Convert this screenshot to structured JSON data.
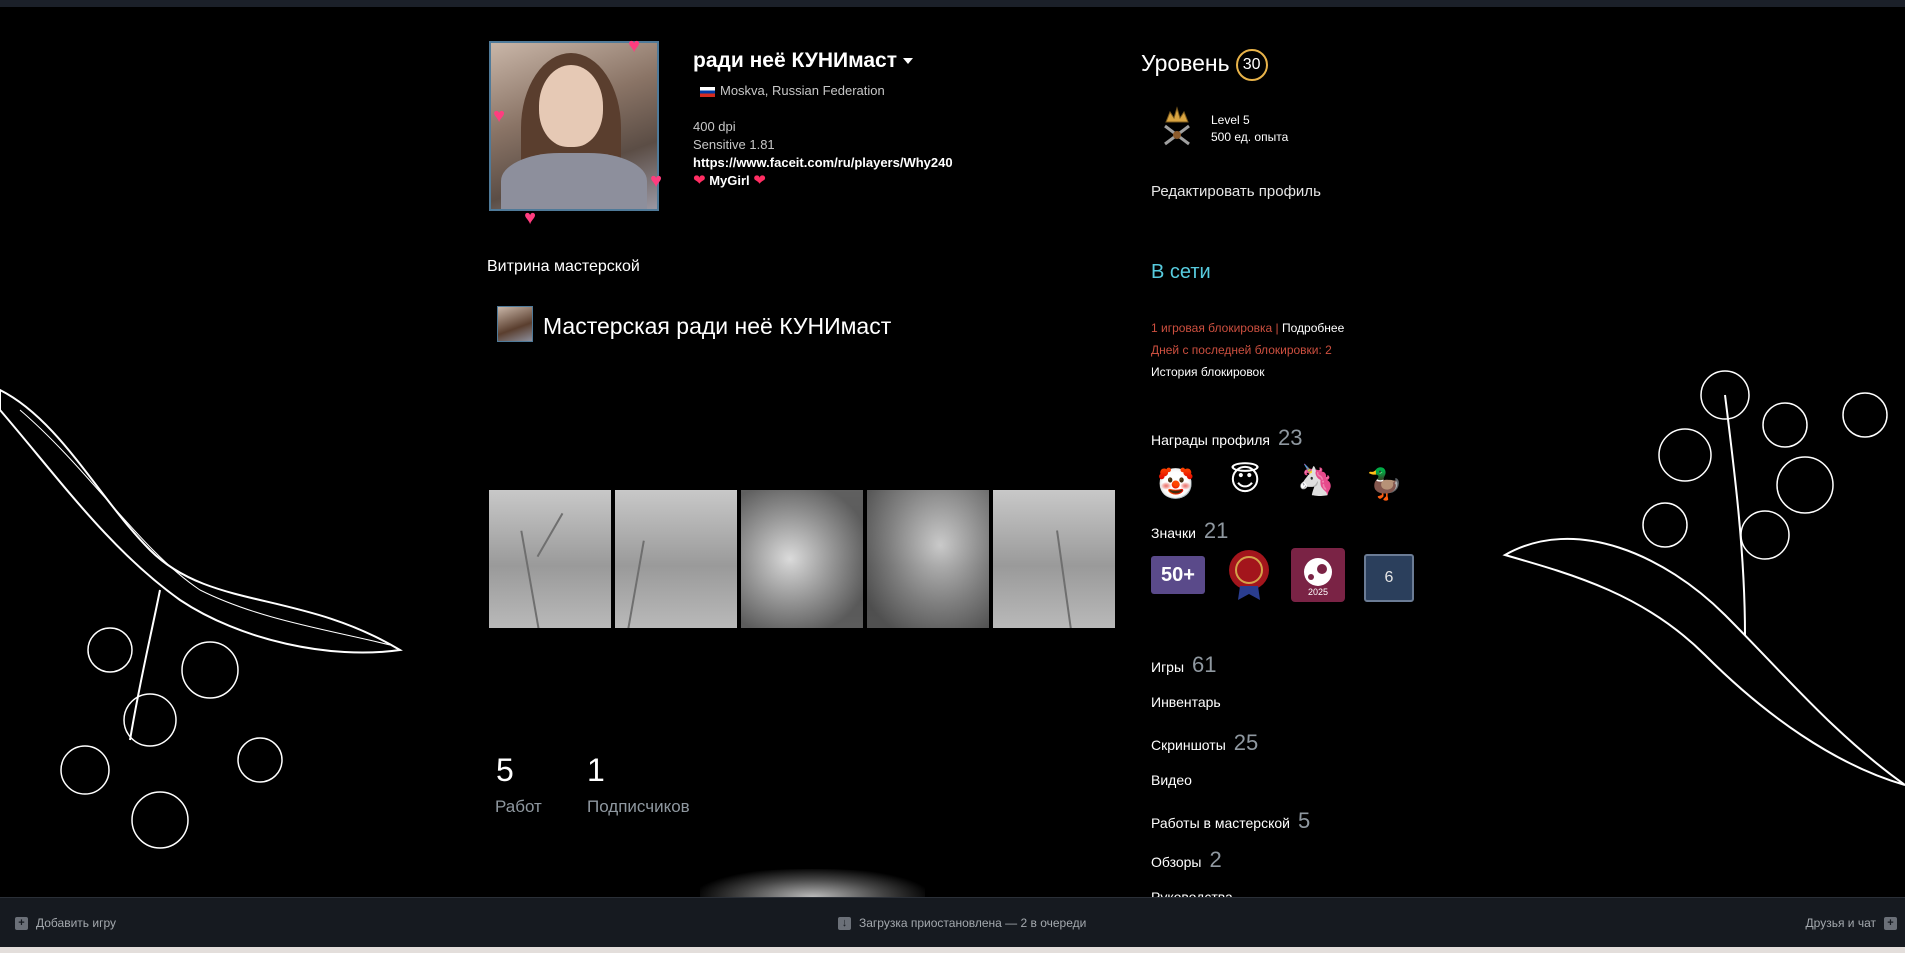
{
  "profile": {
    "name": "ради неё КУНИмаст",
    "location": "Moskva, Russian Federation",
    "summary": {
      "line1": "400 dpi",
      "line2": "Sensitive 1.81",
      "link": "https://www.faceit.com/ru/players/Why240",
      "mygirl": "MyGirl"
    }
  },
  "level": {
    "title": "Уровень",
    "number": "30",
    "badge_line1": "Level 5",
    "badge_line2": "500 ед. опыта"
  },
  "edit_profile": "Редактировать профиль",
  "status": "В сети",
  "bans": {
    "line1_warn": "1 игровая блокировка",
    "separator": "|",
    "line1_more": "Подробнее",
    "line2": "Дней с последней блокировки: 2",
    "history": "История блокировок"
  },
  "awards": {
    "label": "Награды профиля",
    "count": "23"
  },
  "badges": {
    "label": "Значки",
    "count": "21",
    "first_badge_text": "50+",
    "steam_year": "2025",
    "level_badge_text": "6"
  },
  "sidebar_links": [
    {
      "label": "Игры",
      "count": "61"
    },
    {
      "label": "Инвентарь",
      "count": ""
    },
    {
      "label": "Скриншоты",
      "count": "25"
    },
    {
      "label": "Видео",
      "count": ""
    },
    {
      "label": "Работы в мастерской",
      "count": "5"
    },
    {
      "label": "Обзоры",
      "count": "2"
    },
    {
      "label": "Руководства",
      "count": ""
    }
  ],
  "showcase": {
    "title": "Витрина мастерской",
    "workshop_title": "Мастерская ради неё КУНИмаст",
    "works_count": "5",
    "works_label": "Работ",
    "subs_count": "1",
    "subs_label": "Подписчиков"
  },
  "bottombar": {
    "add_game": "Добавить игру",
    "downloads": "Загрузка приостановлена — 2 в очереди",
    "friends": "Друзья и чат"
  },
  "colors": {
    "online": "#57cbde",
    "ban": "#cc4f3f",
    "level_ring": "#e8b34a",
    "avatar_border": "#4f7a99"
  }
}
